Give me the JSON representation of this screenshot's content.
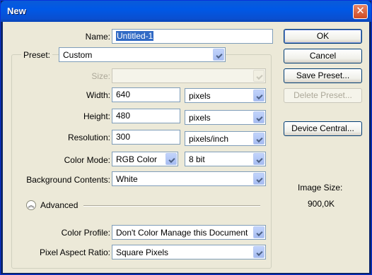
{
  "window": {
    "title": "New"
  },
  "name": {
    "label": "Name:",
    "value": "Untitled-1"
  },
  "preset": {
    "label": "Preset:",
    "value": "Custom"
  },
  "size": {
    "label": "Size:",
    "value": ""
  },
  "width": {
    "label": "Width:",
    "value": "640",
    "unit": "pixels"
  },
  "height": {
    "label": "Height:",
    "value": "480",
    "unit": "pixels"
  },
  "resolution": {
    "label": "Resolution:",
    "value": "300",
    "unit": "pixels/inch"
  },
  "color_mode": {
    "label": "Color Mode:",
    "mode": "RGB Color",
    "depth": "8 bit"
  },
  "background_contents": {
    "label": "Background Contents:",
    "value": "White"
  },
  "advanced": {
    "label": "Advanced"
  },
  "color_profile": {
    "label": "Color Profile:",
    "value": "Don't Color Manage this Document"
  },
  "pixel_aspect": {
    "label": "Pixel Aspect Ratio:",
    "value": "Square Pixels"
  },
  "buttons": {
    "ok": "OK",
    "cancel": "Cancel",
    "save_preset": "Save Preset...",
    "delete_preset": "Delete Preset...",
    "device_central": "Device Central..."
  },
  "image_size": {
    "label": "Image Size:",
    "value": "900,0K"
  }
}
